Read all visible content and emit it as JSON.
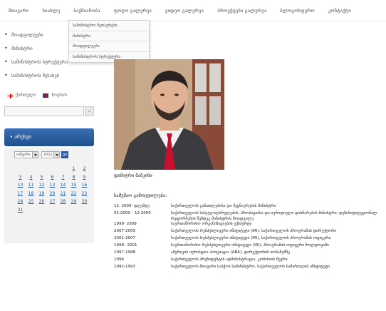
{
  "nav": {
    "items": [
      "მთავარი",
      "სიახლე",
      "საქმიანობა",
      "ფოტო გალერეა",
      "ვიდეო გალერეა",
      "პროექტები გალერეა",
      "ბლოგოსფერო",
      "კონტაქტი"
    ]
  },
  "dropdown": {
    "items": [
      "სამინისტრო მეთაურები",
      "მინისტრი",
      "მოადგილეები",
      "სამინისტროს სტრუქტურა"
    ]
  },
  "sidebar": {
    "menu": [
      "მოადგილეები",
      "მინისტრი",
      "სამინისტროს სტრუქტურა",
      "სამინისტროს შესახებ"
    ],
    "langs": [
      "ქართული",
      "English"
    ],
    "search": {
      "placeholder": "",
      "go": "»"
    },
    "archive_label": "არქივი",
    "calendar": {
      "month": "იანვარი",
      "year": "2011",
      "go": "go",
      "days": [
        "1",
        "2",
        "3",
        "4",
        "5",
        "6",
        "7",
        "8",
        "9",
        "10",
        "11",
        "12",
        "13",
        "14",
        "15",
        "16",
        "17",
        "18",
        "19",
        "20",
        "21",
        "22",
        "23",
        "24",
        "25",
        "26",
        "27",
        "28",
        "29",
        "30",
        "31"
      ]
    }
  },
  "main": {
    "caption": "დიმიტრი შაშკინი",
    "bio_title": "სამუშაო გამოცდილება:",
    "bio": [
      {
        "years": "12. 2009- დღემდე",
        "desc": "საქართველოს განათლებისა და მეცნიერების მინისტრი"
      },
      {
        "years": "02.2009 – 12.2009",
        "desc": "საქართველოს სასჯელაღსრულების, პრობაციისა და იურიდიული დახმარების მინისტრი, დეზინიტიტუციონალ რეფორმების შემდეგ მინისტრის მოადგილე"
      },
      {
        "years": "1998- 2009",
        "desc": "საერთაშორისო ორგანიზაციების ექსპერტი"
      },
      {
        "years": "2007-2009",
        "desc": "საქართველოს რესპუბლიკური ინსტიტუტი (IRI), საქართველოს პროგრამის დირექტორი"
      },
      {
        "years": "2001-2007",
        "desc": "საქართველოს რესპუბლიკური ინსტიტუტი (IRI), საქართველოს პროგრამის ოფიცერი"
      },
      {
        "years": "1998– 2001",
        "desc": "საერთაშორისო რესპუბლიკური ინსტიტუტი (IRI), პროგრამის ოფიცერი მოლდოვაში"
      },
      {
        "years": "1997-1998",
        "desc": "ამერიკის იურისტთა ასოციაცია (ABA), დირექტორის თანაშემწე"
      },
      {
        "years": "1996",
        "desc": "საქართველოს პრეზიდენტის ადმინისტრაცია, კომისიის წევრი"
      },
      {
        "years": "1992-1993",
        "desc": "საქართველოს მთავარი საბჭოს სამინისტრო, საქართველოს სამართლის ინსტიტუტი"
      }
    ]
  },
  "colors": {
    "archive_bar": "#1f4f8e",
    "calendar_link": "#1f5ba8",
    "photo_bg": "#c8a888"
  }
}
